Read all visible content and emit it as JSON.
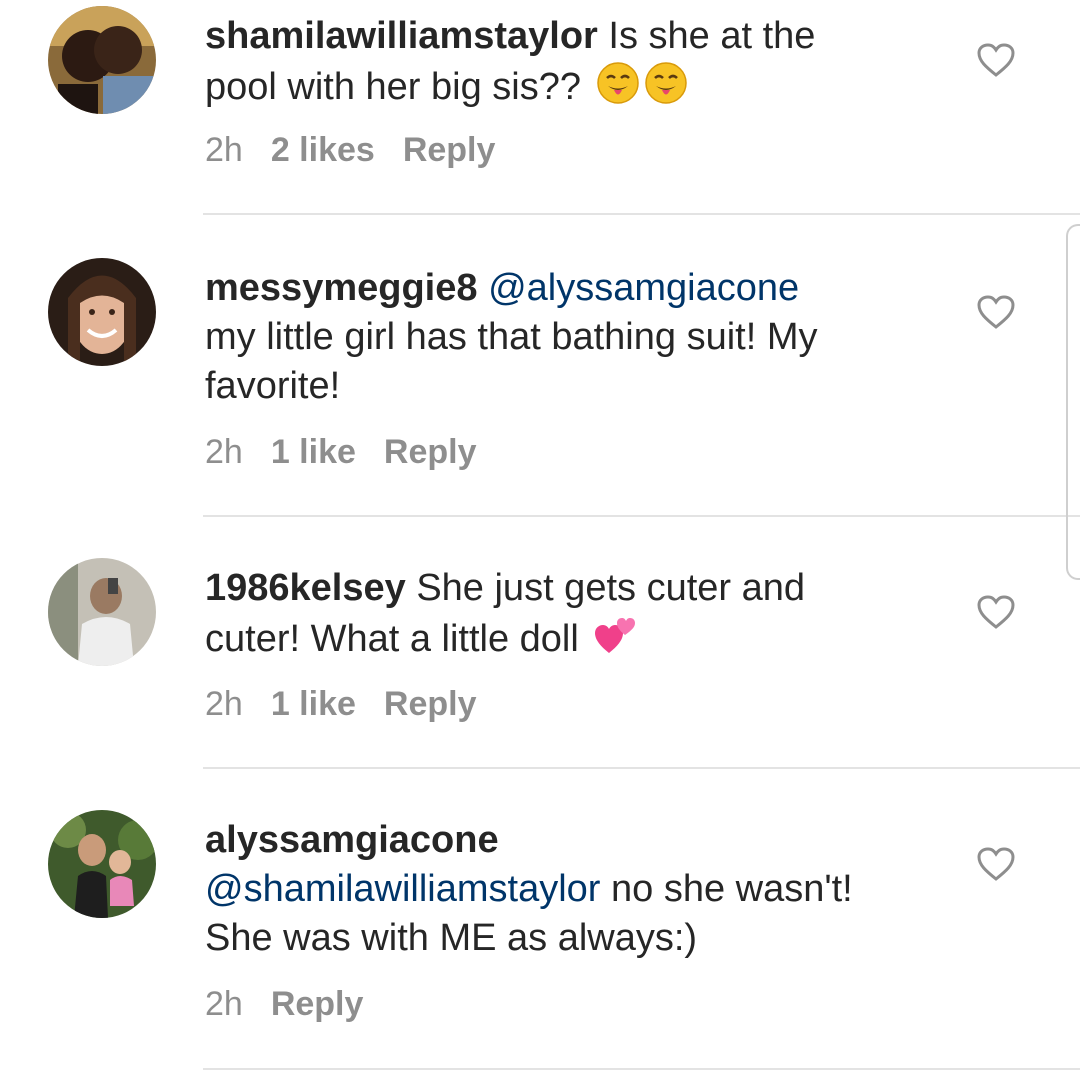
{
  "comments": [
    {
      "username": "shamilawilliamstaylor",
      "mention": "",
      "text_line1": " Is she at the",
      "text_line2": "pool with her big sis?? ",
      "time": "2h",
      "likes": "2 likes",
      "reply": "Reply",
      "emoji": "winking-face-tongue"
    },
    {
      "username": "messymeggie8",
      "mention": "@alyssamgiacone",
      "text_line1": "my little girl has that bathing suit! My",
      "text_line2": "favorite!",
      "time": "2h",
      "likes": "1 like",
      "reply": "Reply"
    },
    {
      "username": "1986kelsey",
      "mention": "",
      "text_line1": " She just gets cuter and",
      "text_line2": "cuter! What a little doll ",
      "time": "2h",
      "likes": "1 like",
      "reply": "Reply",
      "emoji": "two-hearts"
    },
    {
      "username": "alyssamgiacone",
      "mention": "@shamilawilliamstaylor",
      "text_line1": " no she wasn't!",
      "text_line2": "She was with ME as always:)",
      "time": "2h",
      "likes": "",
      "reply": "Reply"
    }
  ],
  "icons": {
    "like": "heart-outline-icon"
  },
  "colors": {
    "text": "#262626",
    "meta": "#8e8e8e",
    "mention": "#003569",
    "divider": "#e3e3e3"
  }
}
